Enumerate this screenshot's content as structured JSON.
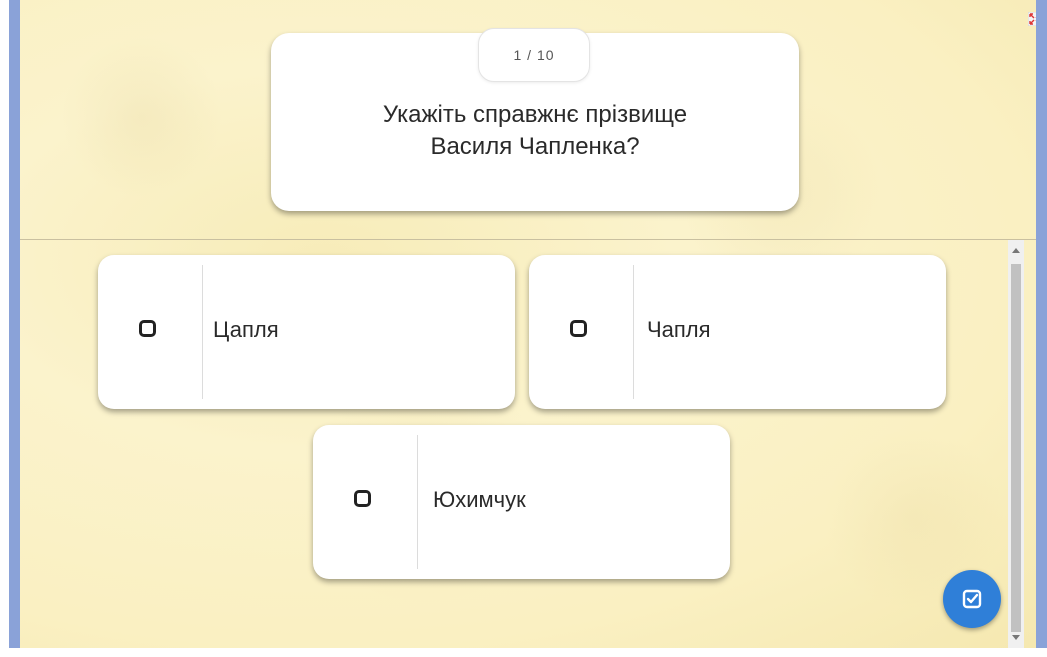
{
  "quiz": {
    "counter": "1 / 10",
    "question_line1": "Укажіть справжнє прізвище",
    "question_line2": "Василя Чапленка?"
  },
  "options": [
    {
      "label": "Цапля",
      "checked": false
    },
    {
      "label": "Чапля",
      "checked": false
    },
    {
      "label": "Юхимчук",
      "checked": false
    }
  ],
  "colors": {
    "background": "#faf0c2",
    "accent": "#2f7fd8",
    "frame": "#8aa2d8"
  },
  "icons": {
    "fullscreen": "fullscreen-icon",
    "submit": "check-square-icon",
    "option_checkbox": "checkbox-icon"
  }
}
